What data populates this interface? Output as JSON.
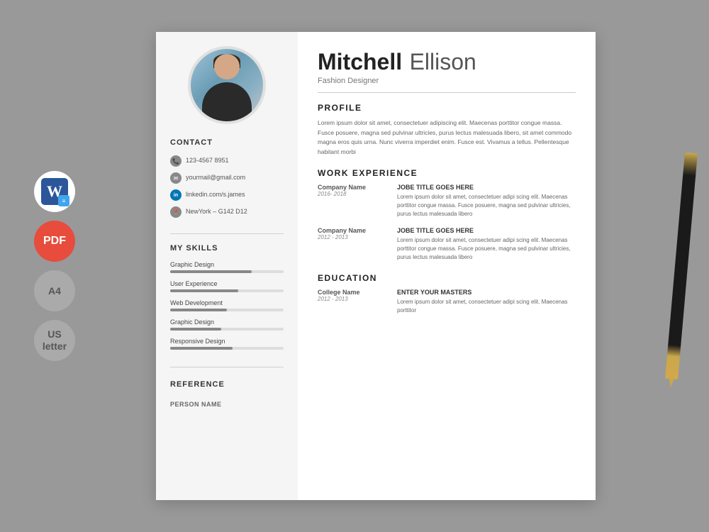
{
  "side_icons": {
    "word_label": "W",
    "pdf_label": "PDF",
    "a4_label": "A4",
    "us_label": "US\nletter"
  },
  "resume": {
    "name": {
      "first": "Mitchell",
      "last": "Ellison"
    },
    "job_title": "Fashion Designer",
    "contact": {
      "section_title": "CONTACT",
      "phone": "123-4567 8951",
      "email": "yourmail@gmail.com",
      "linkedin": "linkedin.com/s.james",
      "address": "NewYork – G142 D12"
    },
    "skills": {
      "section_title": "MY SKILLS",
      "items": [
        {
          "name": "Graphic Design",
          "percent": 72
        },
        {
          "name": "User Experience",
          "percent": 60
        },
        {
          "name": "Web Development",
          "percent": 50
        },
        {
          "name": "Graphic Design",
          "percent": 45
        },
        {
          "name": "Responsive Design",
          "percent": 55
        }
      ]
    },
    "reference": {
      "section_title": "REFERENCE",
      "person_name_label": "PERSON NAME"
    },
    "profile": {
      "section_title": "PROFILE",
      "text": "Lorem ipsum dolor sit amet, consectetuer adipiscing elit. Maecenas porttitor congue massa. Fusce posuere, magna sed pulvinar ultricies, purus lectus malesuada libero, sit amet commodo magna eros quis urna. Nunc viverra imperdiet enim. Fusce est. Vivamus a tellus. Pellentesque habitant morbi"
    },
    "work_experience": {
      "section_title": "WORK EXPERIENCE",
      "entries": [
        {
          "company": "Company Name",
          "dates": "2016- 2018",
          "job_title": "JOBE TITLE GOES HERE",
          "description": "Lorem ipsum dolor sit amet, consectetuer adipi scing elit. Maecenas porttitor congue massa. Fusce posuere, magna sed pulvinar ultricies, purus lectus malesuada libero"
        },
        {
          "company": "Company Name",
          "dates": "2012 - 2013",
          "job_title": "JOBE TITLE GOES HERE",
          "description": "Lorem ipsum dolor sit amet, consectetuer adipi scing elit. Maecenas porttitor congue massa. Fusce posuere, magna sed pulvinar ultricies, purus lectus malesuada libero"
        }
      ]
    },
    "education": {
      "section_title": "EDUCATION",
      "entries": [
        {
          "college": "College Name",
          "dates": "2012 - 2013",
          "degree": "ENTER YOUR MASTERS",
          "description": "Lorem ipsum dolor sit amet, consectetuer adipi scing elit. Maecenas porttitor"
        }
      ]
    }
  }
}
